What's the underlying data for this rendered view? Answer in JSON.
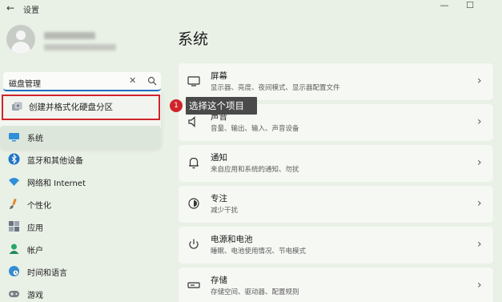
{
  "window": {
    "title": "设置",
    "back_glyph": "←",
    "minimize_glyph": "—",
    "maximize_glyph": "☐"
  },
  "search": {
    "value": "磁盘管理",
    "clear_glyph": "✕"
  },
  "search_result": {
    "label": "创建并格式化硬盘分区",
    "icon": "disk-management-icon"
  },
  "callout": {
    "number": "1",
    "text": "选择这个项目"
  },
  "sidebar": {
    "items": [
      {
        "label": "系统",
        "icon": "monitor-icon",
        "active": true
      },
      {
        "label": "蓝牙和其他设备",
        "icon": "bluetooth-icon"
      },
      {
        "label": "网络和 Internet",
        "icon": "wifi-icon"
      },
      {
        "label": "个性化",
        "icon": "brush-icon"
      },
      {
        "label": "应用",
        "icon": "apps-icon"
      },
      {
        "label": "帐户",
        "icon": "account-icon"
      },
      {
        "label": "时间和语言",
        "icon": "globe-clock-icon"
      },
      {
        "label": "游戏",
        "icon": "gamepad-icon"
      }
    ]
  },
  "main": {
    "title": "系统",
    "cards": [
      {
        "title": "屏幕",
        "subtitle": "显示器、亮度、夜间模式、显示器配置文件",
        "icon": "monitor-icon"
      },
      {
        "title": "声音",
        "subtitle": "音量、输出、输入、声音设备",
        "icon": "speaker-icon"
      },
      {
        "title": "通知",
        "subtitle": "来自应用和系统的通知、勿扰",
        "icon": "bell-icon"
      },
      {
        "title": "专注",
        "subtitle": "减少干扰",
        "icon": "focus-icon"
      },
      {
        "title": "电源和电池",
        "subtitle": "睡眠、电池使用情况、节电模式",
        "icon": "power-icon"
      },
      {
        "title": "存储",
        "subtitle": "存储空间、驱动器、配置规则",
        "icon": "storage-icon"
      }
    ],
    "chevron_glyph": "›"
  },
  "colors": {
    "accent": "#1d6fc4",
    "highlight_border": "#d0242b",
    "callout_bg": "#4a4a4a",
    "background": "#e9f0e6",
    "card": "#f6f8f4"
  }
}
